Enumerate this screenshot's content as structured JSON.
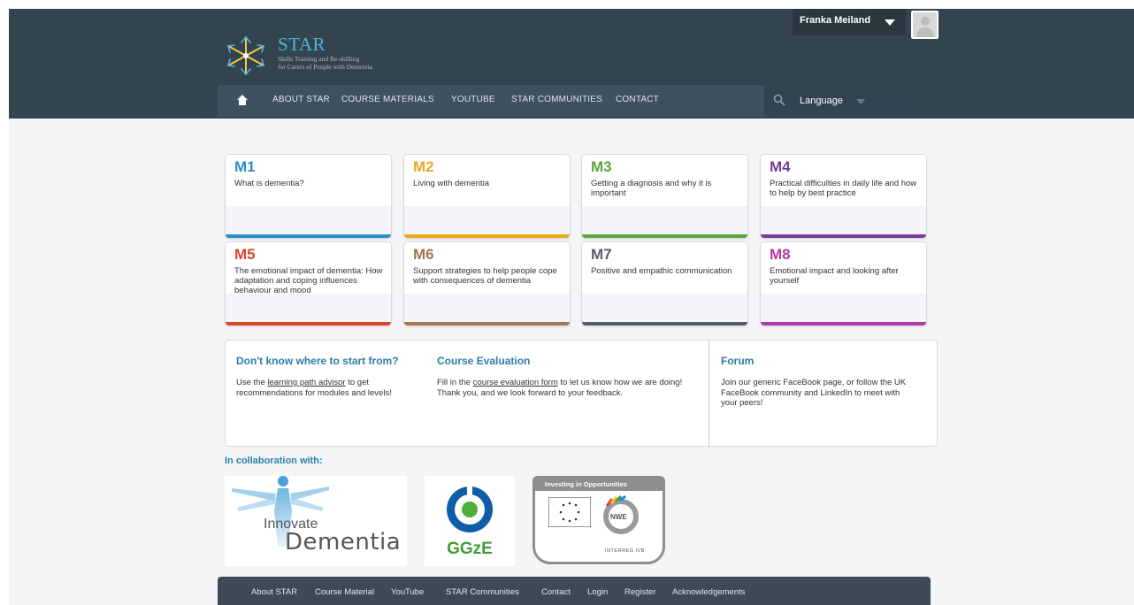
{
  "header": {
    "logo_title": "STAR",
    "logo_subtitle_line1": "Skills Training and Re-skilling",
    "logo_subtitle_line2": "for Carers of People with Dementia",
    "user_name": "Franka Meiland",
    "nav": [
      "ABOUT STAR",
      "COURSE MATERIALS",
      "YOUTUBE",
      "STAR COMMUNITIES",
      "CONTACT"
    ],
    "language_label": "Language"
  },
  "modules": [
    {
      "code": "M1",
      "title": "What is dementia?",
      "color": "#2d8fc8"
    },
    {
      "code": "M2",
      "title": "Living with dementia",
      "color": "#e8a91f"
    },
    {
      "code": "M3",
      "title": "Getting a diagnosis and why it is important",
      "color": "#5aa53a"
    },
    {
      "code": "M4",
      "title": "Practical difficulties in daily life and how to help by best practice",
      "color": "#7a3d97"
    },
    {
      "code": "M5",
      "title": "The emotional impact of dementia: How adaptation and coping influences behaviour and mood",
      "color": "#d8482c"
    },
    {
      "code": "M6",
      "title": "Support strategies to help people cope with consequences of dementia",
      "color": "#a07850"
    },
    {
      "code": "M7",
      "title": "Positive and empathic communication",
      "color": "#555f66"
    },
    {
      "code": "M8",
      "title": "Emotional impact and looking after yourself",
      "color": "#b03aa8"
    }
  ],
  "info": {
    "start": {
      "title": "Don't know where to start from?",
      "text_before": "Use the ",
      "link": "learning path advisor",
      "text_after": " to get recommendations for modules and levels!"
    },
    "evaluation": {
      "title": "Course Evaluation",
      "text_before": "Fill in the ",
      "link": "course evaluation form",
      "text_after": " to let us know how we are doing! Thank you, and we look forward to your feedback."
    },
    "forum": {
      "title": "Forum",
      "text": "Join our generic FaceBook page, or follow the UK FaceBook community and LinkedIn to meet with your peers!"
    }
  },
  "collaboration": {
    "label": "In collaboration with:",
    "innovate_line1": "Innovate",
    "innovate_line2": "Dementia",
    "ggze": "GGzE",
    "interreg_banner": "Investing in Opportunities",
    "interreg_text": "INTERREG IVB",
    "nwe": "NWE"
  },
  "footer": [
    "About STAR",
    "Course Material",
    "YouTube",
    "STAR Communities",
    "Contact",
    "Login",
    "Register",
    "Acknowledgements"
  ]
}
